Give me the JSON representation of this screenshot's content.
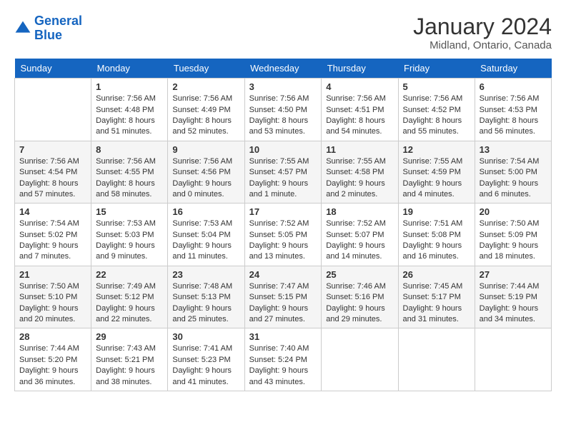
{
  "header": {
    "logo_line1": "General",
    "logo_line2": "Blue",
    "title": "January 2024",
    "subtitle": "Midland, Ontario, Canada"
  },
  "days_of_week": [
    "Sunday",
    "Monday",
    "Tuesday",
    "Wednesday",
    "Thursday",
    "Friday",
    "Saturday"
  ],
  "weeks": [
    [
      {
        "day": "",
        "sunrise": "",
        "sunset": "",
        "daylight": ""
      },
      {
        "day": "1",
        "sunrise": "Sunrise: 7:56 AM",
        "sunset": "Sunset: 4:48 PM",
        "daylight": "Daylight: 8 hours and 51 minutes."
      },
      {
        "day": "2",
        "sunrise": "Sunrise: 7:56 AM",
        "sunset": "Sunset: 4:49 PM",
        "daylight": "Daylight: 8 hours and 52 minutes."
      },
      {
        "day": "3",
        "sunrise": "Sunrise: 7:56 AM",
        "sunset": "Sunset: 4:50 PM",
        "daylight": "Daylight: 8 hours and 53 minutes."
      },
      {
        "day": "4",
        "sunrise": "Sunrise: 7:56 AM",
        "sunset": "Sunset: 4:51 PM",
        "daylight": "Daylight: 8 hours and 54 minutes."
      },
      {
        "day": "5",
        "sunrise": "Sunrise: 7:56 AM",
        "sunset": "Sunset: 4:52 PM",
        "daylight": "Daylight: 8 hours and 55 minutes."
      },
      {
        "day": "6",
        "sunrise": "Sunrise: 7:56 AM",
        "sunset": "Sunset: 4:53 PM",
        "daylight": "Daylight: 8 hours and 56 minutes."
      }
    ],
    [
      {
        "day": "7",
        "sunrise": "Sunrise: 7:56 AM",
        "sunset": "Sunset: 4:54 PM",
        "daylight": "Daylight: 8 hours and 57 minutes."
      },
      {
        "day": "8",
        "sunrise": "Sunrise: 7:56 AM",
        "sunset": "Sunset: 4:55 PM",
        "daylight": "Daylight: 8 hours and 58 minutes."
      },
      {
        "day": "9",
        "sunrise": "Sunrise: 7:56 AM",
        "sunset": "Sunset: 4:56 PM",
        "daylight": "Daylight: 9 hours and 0 minutes."
      },
      {
        "day": "10",
        "sunrise": "Sunrise: 7:55 AM",
        "sunset": "Sunset: 4:57 PM",
        "daylight": "Daylight: 9 hours and 1 minute."
      },
      {
        "day": "11",
        "sunrise": "Sunrise: 7:55 AM",
        "sunset": "Sunset: 4:58 PM",
        "daylight": "Daylight: 9 hours and 2 minutes."
      },
      {
        "day": "12",
        "sunrise": "Sunrise: 7:55 AM",
        "sunset": "Sunset: 4:59 PM",
        "daylight": "Daylight: 9 hours and 4 minutes."
      },
      {
        "day": "13",
        "sunrise": "Sunrise: 7:54 AM",
        "sunset": "Sunset: 5:00 PM",
        "daylight": "Daylight: 9 hours and 6 minutes."
      }
    ],
    [
      {
        "day": "14",
        "sunrise": "Sunrise: 7:54 AM",
        "sunset": "Sunset: 5:02 PM",
        "daylight": "Daylight: 9 hours and 7 minutes."
      },
      {
        "day": "15",
        "sunrise": "Sunrise: 7:53 AM",
        "sunset": "Sunset: 5:03 PM",
        "daylight": "Daylight: 9 hours and 9 minutes."
      },
      {
        "day": "16",
        "sunrise": "Sunrise: 7:53 AM",
        "sunset": "Sunset: 5:04 PM",
        "daylight": "Daylight: 9 hours and 11 minutes."
      },
      {
        "day": "17",
        "sunrise": "Sunrise: 7:52 AM",
        "sunset": "Sunset: 5:05 PM",
        "daylight": "Daylight: 9 hours and 13 minutes."
      },
      {
        "day": "18",
        "sunrise": "Sunrise: 7:52 AM",
        "sunset": "Sunset: 5:07 PM",
        "daylight": "Daylight: 9 hours and 14 minutes."
      },
      {
        "day": "19",
        "sunrise": "Sunrise: 7:51 AM",
        "sunset": "Sunset: 5:08 PM",
        "daylight": "Daylight: 9 hours and 16 minutes."
      },
      {
        "day": "20",
        "sunrise": "Sunrise: 7:50 AM",
        "sunset": "Sunset: 5:09 PM",
        "daylight": "Daylight: 9 hours and 18 minutes."
      }
    ],
    [
      {
        "day": "21",
        "sunrise": "Sunrise: 7:50 AM",
        "sunset": "Sunset: 5:10 PM",
        "daylight": "Daylight: 9 hours and 20 minutes."
      },
      {
        "day": "22",
        "sunrise": "Sunrise: 7:49 AM",
        "sunset": "Sunset: 5:12 PM",
        "daylight": "Daylight: 9 hours and 22 minutes."
      },
      {
        "day": "23",
        "sunrise": "Sunrise: 7:48 AM",
        "sunset": "Sunset: 5:13 PM",
        "daylight": "Daylight: 9 hours and 25 minutes."
      },
      {
        "day": "24",
        "sunrise": "Sunrise: 7:47 AM",
        "sunset": "Sunset: 5:15 PM",
        "daylight": "Daylight: 9 hours and 27 minutes."
      },
      {
        "day": "25",
        "sunrise": "Sunrise: 7:46 AM",
        "sunset": "Sunset: 5:16 PM",
        "daylight": "Daylight: 9 hours and 29 minutes."
      },
      {
        "day": "26",
        "sunrise": "Sunrise: 7:45 AM",
        "sunset": "Sunset: 5:17 PM",
        "daylight": "Daylight: 9 hours and 31 minutes."
      },
      {
        "day": "27",
        "sunrise": "Sunrise: 7:44 AM",
        "sunset": "Sunset: 5:19 PM",
        "daylight": "Daylight: 9 hours and 34 minutes."
      }
    ],
    [
      {
        "day": "28",
        "sunrise": "Sunrise: 7:44 AM",
        "sunset": "Sunset: 5:20 PM",
        "daylight": "Daylight: 9 hours and 36 minutes."
      },
      {
        "day": "29",
        "sunrise": "Sunrise: 7:43 AM",
        "sunset": "Sunset: 5:21 PM",
        "daylight": "Daylight: 9 hours and 38 minutes."
      },
      {
        "day": "30",
        "sunrise": "Sunrise: 7:41 AM",
        "sunset": "Sunset: 5:23 PM",
        "daylight": "Daylight: 9 hours and 41 minutes."
      },
      {
        "day": "31",
        "sunrise": "Sunrise: 7:40 AM",
        "sunset": "Sunset: 5:24 PM",
        "daylight": "Daylight: 9 hours and 43 minutes."
      },
      {
        "day": "",
        "sunrise": "",
        "sunset": "",
        "daylight": ""
      },
      {
        "day": "",
        "sunrise": "",
        "sunset": "",
        "daylight": ""
      },
      {
        "day": "",
        "sunrise": "",
        "sunset": "",
        "daylight": ""
      }
    ]
  ]
}
